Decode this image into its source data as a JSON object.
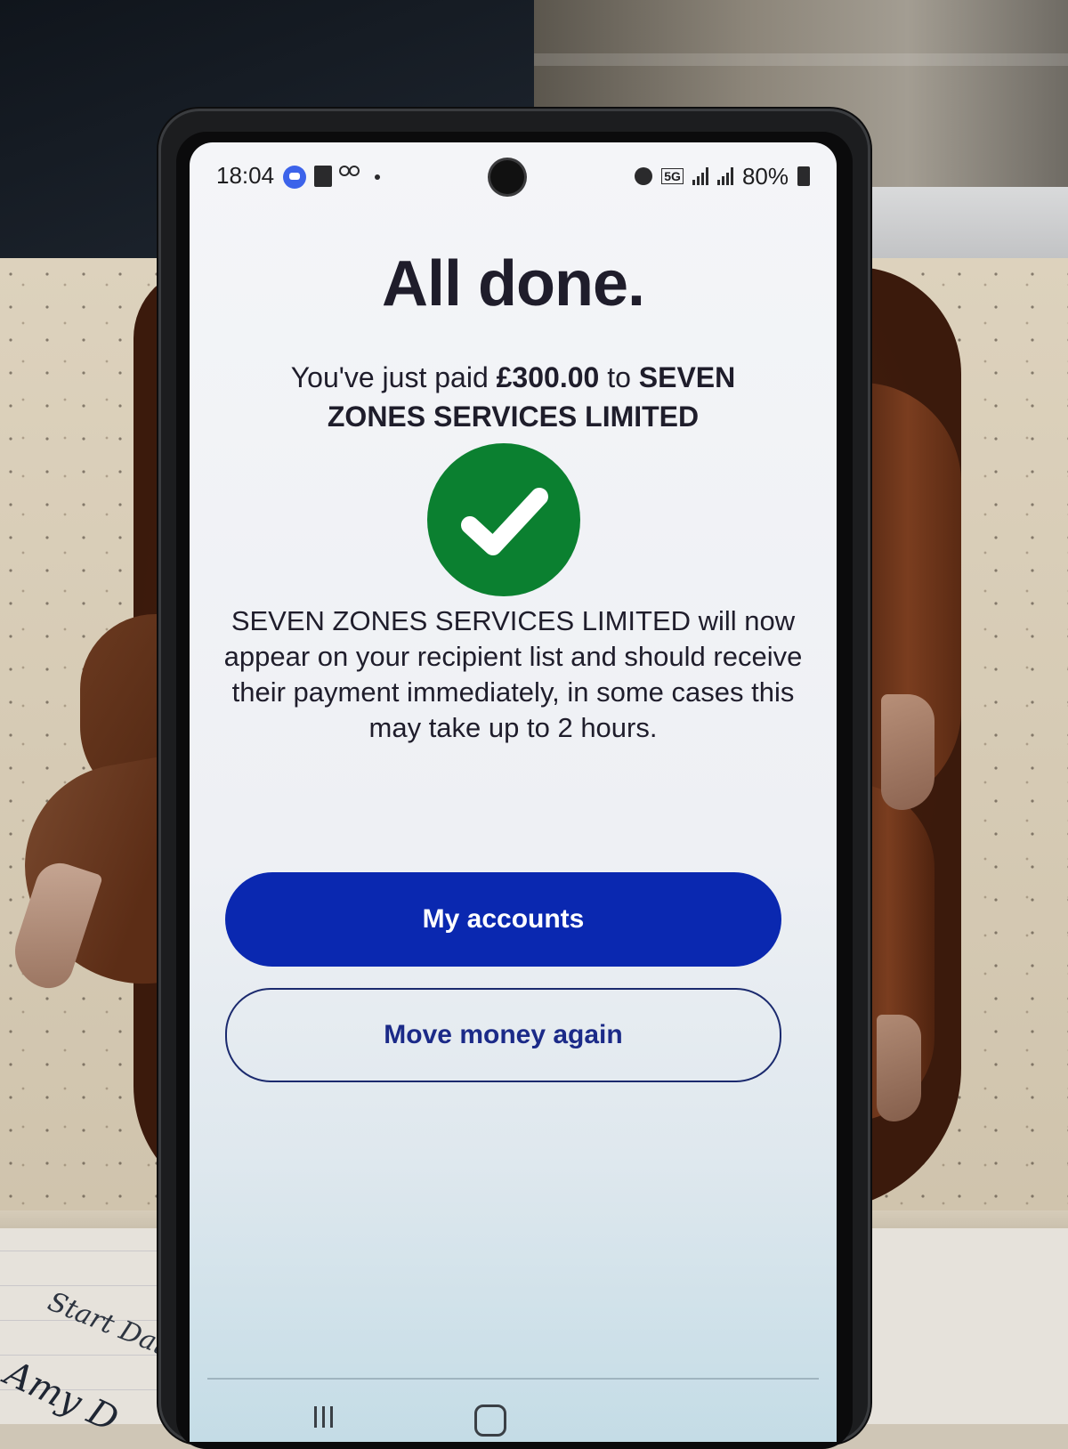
{
  "background": {
    "handwriting_line1": "Start Date",
    "handwriting_line2": "Amy D"
  },
  "status_bar": {
    "time": "18:04",
    "network": "5G",
    "battery": "80%"
  },
  "confirmation": {
    "title": "All done.",
    "paid_prefix": "You've just paid ",
    "amount": "£300.00",
    "paid_mid": " to ",
    "recipient": "SEVEN ZONES SERVICES LIMITED",
    "info_text": "SEVEN ZONES SERVICES LIMITED will now appear on your recipient list and should receive their payment immediately, in some cases this may take up to 2 hours."
  },
  "actions": {
    "primary_label": "My accounts",
    "secondary_label": "Move money again"
  },
  "colors": {
    "primary_button": "#0a28b0",
    "success_check": "#0b8030",
    "title_text": "#1f1d2b"
  },
  "icons": {
    "success": "checkmark-icon",
    "status": [
      "messages-icon",
      "pdf-icon",
      "voicemail-icon",
      "alarm-icon",
      "signal-icon",
      "battery-icon"
    ]
  }
}
